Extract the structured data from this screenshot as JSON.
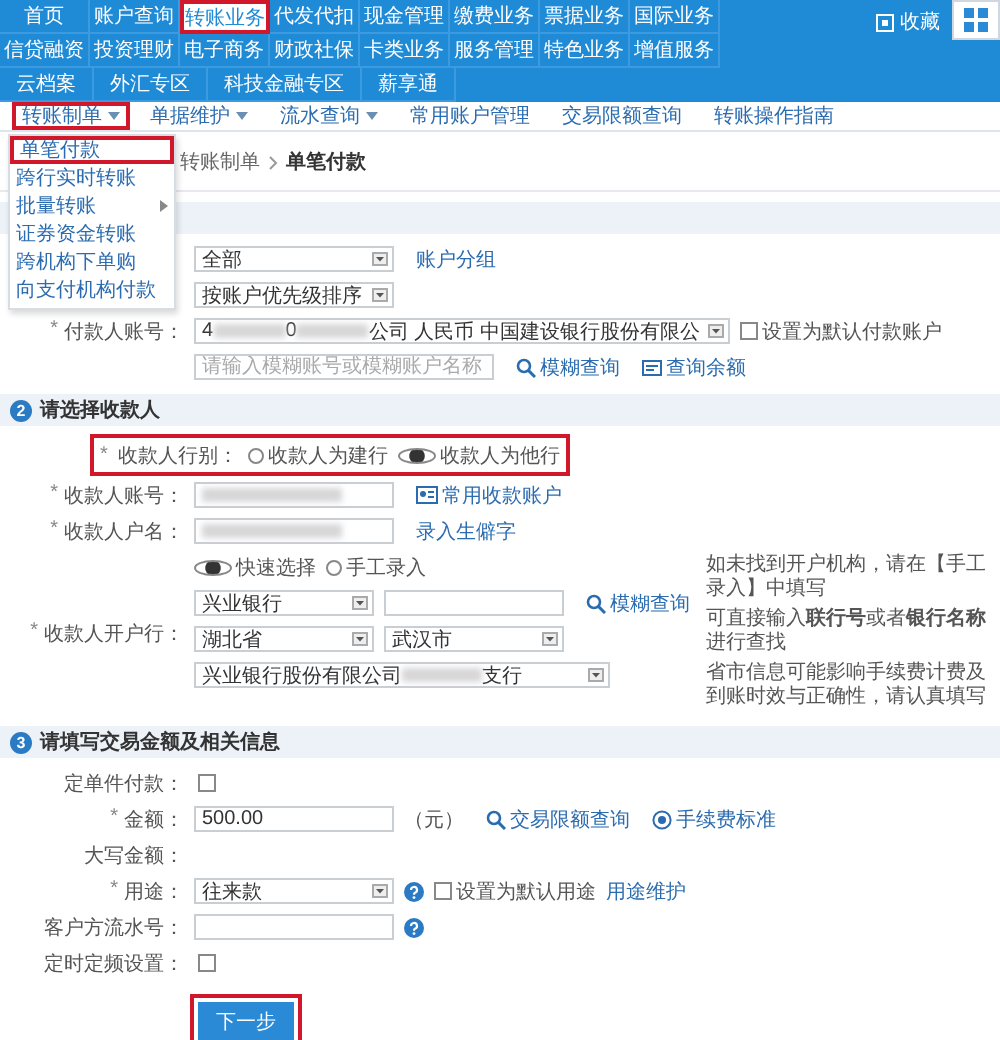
{
  "required_mark": "*",
  "top_nav": {
    "rows": [
      [
        {
          "label": "首页",
          "selected": false
        },
        {
          "label": "账户查询",
          "selected": false
        },
        {
          "label": "转账业务",
          "selected": true
        },
        {
          "label": "代发代扣",
          "selected": false
        },
        {
          "label": "现金管理",
          "selected": false
        },
        {
          "label": "缴费业务",
          "selected": false
        },
        {
          "label": "票据业务",
          "selected": false
        },
        {
          "label": "国际业务",
          "selected": false
        }
      ],
      [
        {
          "label": "信贷融资",
          "selected": false
        },
        {
          "label": "投资理财",
          "selected": false
        },
        {
          "label": "电子商务",
          "selected": false
        },
        {
          "label": "财政社保",
          "selected": false
        },
        {
          "label": "卡类业务",
          "selected": false
        },
        {
          "label": "服务管理",
          "selected": false
        },
        {
          "label": "特色业务",
          "selected": false
        },
        {
          "label": "增值服务",
          "selected": false
        }
      ]
    ],
    "zones": [
      {
        "label": "云档案",
        "selected": false
      },
      {
        "label": "外汇专区",
        "selected": false
      },
      {
        "label": "科技金融专区",
        "selected": false
      },
      {
        "label": "薪享通",
        "selected": false
      }
    ],
    "favorites": "收藏"
  },
  "sub_nav": [
    {
      "label": "转账制单",
      "has_menu": true,
      "selected": true
    },
    {
      "label": "单据维护",
      "has_menu": true,
      "selected": false
    },
    {
      "label": "流水查询",
      "has_menu": true,
      "selected": false
    },
    {
      "label": "常用账户管理",
      "has_menu": false,
      "selected": false
    },
    {
      "label": "交易限额查询",
      "has_menu": false,
      "selected": false
    },
    {
      "label": "转账操作指南",
      "has_menu": false,
      "selected": false
    }
  ],
  "menu": [
    {
      "label": "单笔付款",
      "selected": true,
      "submenu": false
    },
    {
      "label": "跨行实时转账",
      "selected": false,
      "submenu": false
    },
    {
      "label": "批量转账",
      "selected": false,
      "submenu": true
    },
    {
      "label": "证券资金转账",
      "selected": false,
      "submenu": false
    },
    {
      "label": "跨机构下单购",
      "selected": false,
      "submenu": false
    },
    {
      "label": "向支付机构付款",
      "selected": false,
      "submenu": false
    }
  ],
  "breadcrumb": [
    "转账制单",
    "单笔付款"
  ],
  "payer": {
    "group_select": "全部",
    "group_link": "账户分组",
    "sort_select": "按账户优先级排序",
    "account_label": "付款人账号：",
    "account_value": [
      {
        "kind": "text",
        "text": "4"
      },
      {
        "kind": "blur"
      },
      {
        "kind": "text",
        "text": "0"
      },
      {
        "kind": "blur"
      },
      {
        "kind": "text",
        "text": "公司 人民币 中国建设银行股份有限公"
      }
    ],
    "default_checkbox": {
      "label": "设置为默认付款账户",
      "checked": false
    },
    "search_placeholder": "请输入模糊账号或模糊账户名称",
    "search_link": "模糊查询",
    "balance_link": "查询余额"
  },
  "payee": {
    "number": "2",
    "title": "请选择收款人",
    "type_label": "收款人行别：",
    "highlighted": true,
    "type_options": [
      {
        "label": "收款人为建行",
        "selected": false
      },
      {
        "label": "收款人为他行",
        "selected": true
      }
    ],
    "account_label": "收款人账号：",
    "account_value": [
      {
        "kind": "blur"
      }
    ],
    "account_link": "常用收款账户",
    "name_label": "收款人户名：",
    "name_value": [
      {
        "kind": "blur"
      }
    ],
    "name_link": "录入生僻字",
    "bank_label": "收款人开户行：",
    "bank_modes": [
      {
        "label": "快速选择",
        "selected": true
      },
      {
        "label": "手工录入",
        "selected": false
      }
    ],
    "bank_select": "兴业银行",
    "bank_link": "模糊查询",
    "province": "湖北省",
    "city": "武汉市",
    "branch_value": [
      {
        "kind": "text",
        "text": "兴业银行股份有限公司"
      },
      {
        "kind": "blur"
      },
      {
        "kind": "text",
        "text": "支行"
      }
    ],
    "notes": [
      "如未找到开户机构，请在【手工录入】中填写",
      "可直接输入**联行号**或者**银行名称**进行查找",
      "省市信息可能影响手续费计费及到账时效与正确性，请认真填写"
    ]
  },
  "details": {
    "number": "3",
    "title": "请填写交易金额及相关信息",
    "fields": [
      {
        "kind": "checkbox",
        "label": "定单件付款：",
        "required": false,
        "checked": false
      },
      {
        "kind": "amount",
        "label": "金额：",
        "required": true,
        "value": "500.00",
        "unit": "（元）",
        "limit_link": "交易限额查询",
        "fee_link": "手续费标准"
      },
      {
        "kind": "static",
        "label": "大写金额：",
        "required": false
      },
      {
        "kind": "purpose",
        "label": "用途：",
        "required": true,
        "value": "往来款",
        "checkbox": {
          "label": "设置为默认用途",
          "checked": false
        },
        "link": "用途维护"
      },
      {
        "kind": "input",
        "label": "客户方流水号：",
        "required": false
      },
      {
        "kind": "checkbox",
        "label": "定时定频设置：",
        "required": false,
        "checked": false
      }
    ]
  },
  "next_button": {
    "label": "下一步",
    "highlighted": true
  }
}
